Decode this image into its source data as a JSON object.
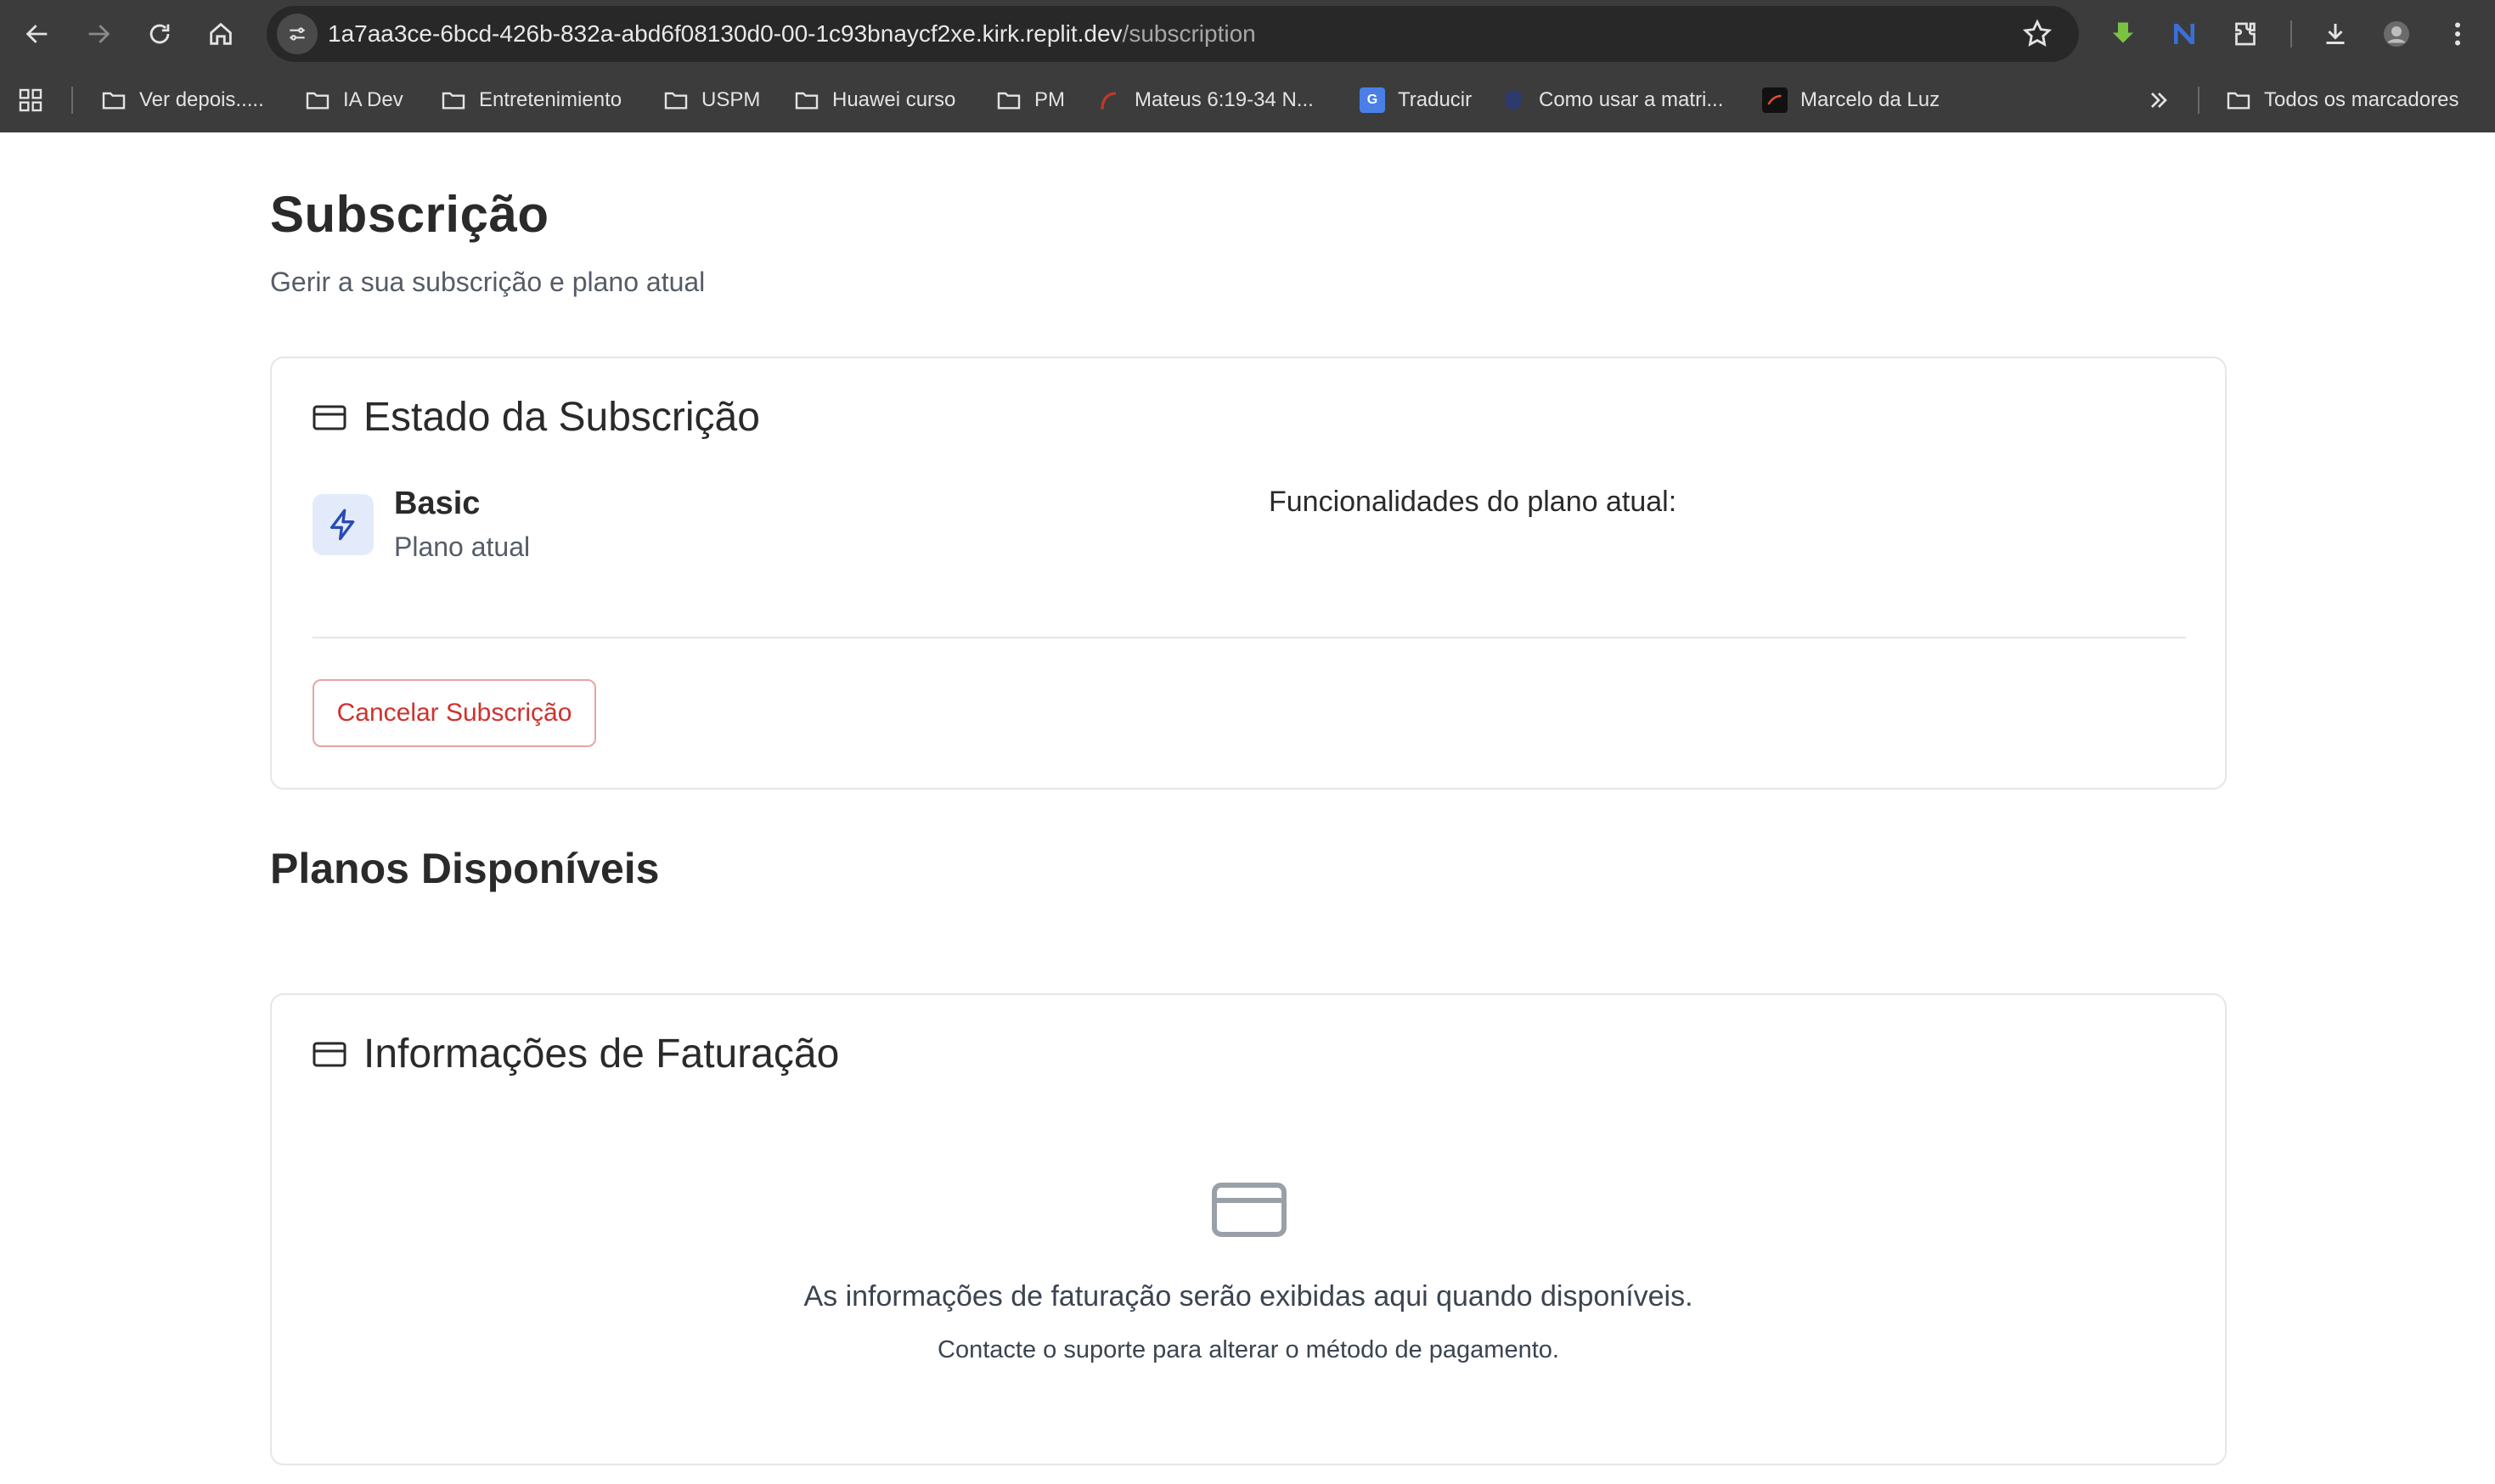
{
  "browser": {
    "url_host": "1a7aa3ce-6bcd-426b-832a-abd6f08130d0-00-1c93bnaycf2xe.kirk.replit.dev",
    "url_path": "/subscription",
    "bookmarks": [
      {
        "label": "Ver depois.....",
        "icon": "folder-icon"
      },
      {
        "label": "IA Dev",
        "icon": "folder-icon"
      },
      {
        "label": "Entretenimiento",
        "icon": "folder-icon"
      },
      {
        "label": "USPM",
        "icon": "folder-icon"
      },
      {
        "label": "Huawei curso",
        "icon": "folder-icon"
      },
      {
        "label": "PM",
        "icon": "folder-icon"
      },
      {
        "label": "Mateus 6:19-34 N...",
        "icon": "favicon-icon"
      },
      {
        "label": "Traducir",
        "icon": "google-translate-icon"
      },
      {
        "label": "Como usar a matri...",
        "icon": "favicon-icon"
      },
      {
        "label": "Marcelo da Luz",
        "icon": "favicon-icon"
      }
    ],
    "all_bookmarks": "Todos os marcadores"
  },
  "page": {
    "title": "Subscrição",
    "subtitle": "Gerir a sua subscrição e plano atual"
  },
  "status_card": {
    "title": "Estado da Subscrição",
    "plan_name": "Basic",
    "plan_label": "Plano atual",
    "features_label": "Funcionalidades do plano atual:",
    "cancel_label": "Cancelar Subscrição"
  },
  "plans": {
    "title": "Planos Disponíveis"
  },
  "billing_card": {
    "title": "Informações de Faturação",
    "message": "As informações de faturação serão exibidas aqui quando disponíveis.",
    "hint": "Contacte o suporte para alterar o método de pagamento."
  },
  "colors": {
    "accent_blue": "#2a4bb5",
    "danger_red": "#d0312d",
    "chrome_bg": "#3c3c3c"
  }
}
